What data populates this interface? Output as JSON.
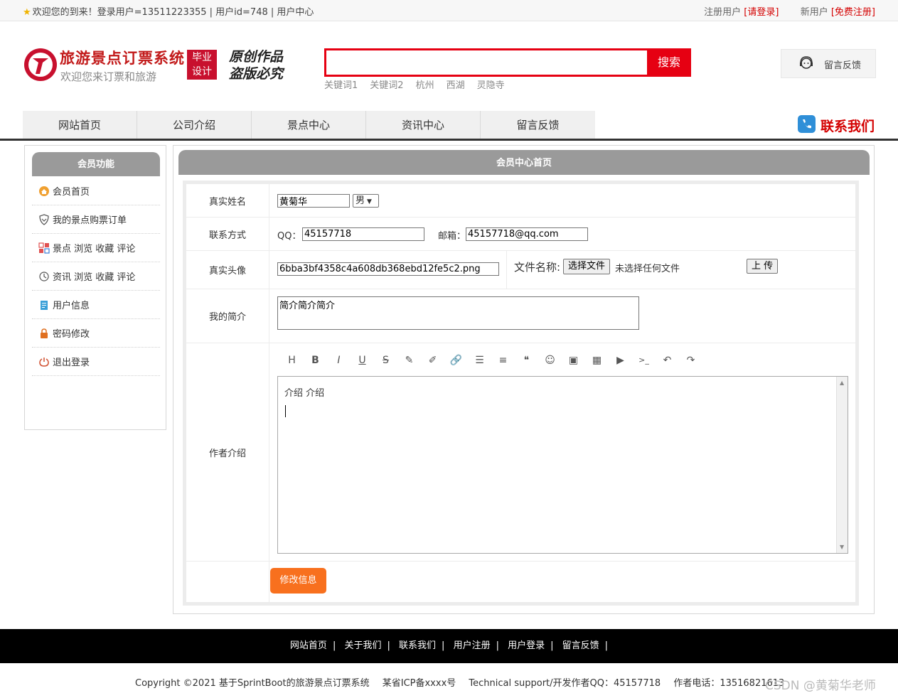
{
  "topbar": {
    "welcome": "欢迎您的到来！登录用户=13511223355 | 用户id=748 | 用户中心",
    "register_user": "注册用户",
    "login_link": "[请登录]",
    "new_user": "新用户",
    "register_link": "[免费注册]"
  },
  "header": {
    "site_title": "旅游景点订票系统",
    "site_subtitle": "欢迎您来订票和旅游",
    "badge_line1": "毕业",
    "badge_line2": "设计",
    "slogan_line1": "原创作品",
    "slogan_line2": "盗版必究",
    "search_button": "搜索",
    "search_value": "",
    "hotwords": [
      "关键词1",
      "关键词2",
      "杭州",
      "西湖",
      "灵隐寺"
    ],
    "feedback": "留言反馈",
    "contact": "联系我们"
  },
  "nav": [
    "网站首页",
    "公司介绍",
    "景点中心",
    "资讯中心",
    "留言反馈"
  ],
  "sidebar": {
    "title": "会员功能",
    "items": [
      {
        "label": "会员首页",
        "icon": "home-icon"
      },
      {
        "label": "我的景点购票订单",
        "icon": "shield-icon"
      },
      {
        "label": "景点 浏览 收藏 评论",
        "icon": "apps-icon"
      },
      {
        "label": "资讯 浏览 收藏 评论",
        "icon": "history-icon"
      },
      {
        "label": "用户信息",
        "icon": "clipboard-icon"
      },
      {
        "label": "密码修改",
        "icon": "lock-icon"
      },
      {
        "label": "退出登录",
        "icon": "power-icon"
      }
    ]
  },
  "main": {
    "title": "会员中心首页",
    "form": {
      "name_label": "真实姓名",
      "name_value": "黄菊华",
      "gender_value": "男",
      "contact_label": "联系方式",
      "qq_label": "QQ：",
      "qq_value": "45157718",
      "email_label": "邮箱：",
      "email_value": "45157718@qq.com",
      "avatar_label": "真实头像",
      "avatar_value": "6bba3bf4358c4a608db368ebd12fe5c2.png",
      "file_name_label": "文件名称:",
      "choose_file": "选择文件",
      "no_file": "未选择任何文件",
      "upload": "上 传",
      "intro_label": "我的简介",
      "intro_value": "简介简介简介",
      "author_label": "作者介绍",
      "author_value": "介绍  介绍",
      "submit": "修改信息"
    },
    "toolbar": [
      "H",
      "B",
      "I",
      "U",
      "S",
      "✎",
      "✐",
      "🔗",
      "☰",
      "≡",
      "❝",
      "☺",
      "▣",
      "▦",
      "▶",
      ">_",
      "↶",
      "↷"
    ]
  },
  "footer": {
    "links": [
      "网站首页",
      "关于我们",
      "联系我们",
      "用户注册",
      "用户登录",
      "留言反馈"
    ],
    "copyright": "Copyright ©2021 基于SprintBoot的旅游景点订票系统",
    "icp": "某省ICP备xxxx号",
    "support": "Technical support/开发作者QQ：45157718",
    "phone": "作者电话：13516821613",
    "watermark": "CSDN @黄菊华老师"
  }
}
